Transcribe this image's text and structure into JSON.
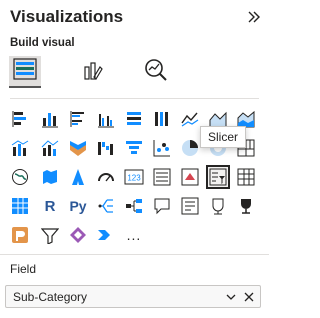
{
  "header": {
    "title": "Visualizations",
    "collapse_icon": "double-chevron-right-icon"
  },
  "build": {
    "title": "Build visual",
    "modes": [
      {
        "icon": "build-visual-icon",
        "active": true
      },
      {
        "icon": "format-visual-icon",
        "active": false
      },
      {
        "icon": "analytics-icon",
        "active": false
      }
    ]
  },
  "visuals": [
    "stacked-bar-icon",
    "stacked-column-icon",
    "clustered-bar-icon",
    "clustered-column-icon",
    "100-stacked-bar-icon",
    "100-stacked-column-icon",
    "line-chart-icon",
    "area-chart-icon",
    "stacked-area-icon",
    "line-clustered-column-icon",
    "line-stacked-column-icon",
    "ribbon-chart-icon",
    "waterfall-chart-icon",
    "funnel-chart-icon",
    "scatter-chart-icon",
    "pie-chart-icon",
    "donut-chart-icon",
    "treemap-icon",
    "map-icon",
    "filled-map-icon",
    "azure-map-icon",
    "gauge-icon",
    "card-icon",
    "multi-row-card-icon",
    "kpi-icon",
    "slicer-icon",
    "table-icon",
    "matrix-icon",
    "r-visual-icon",
    "python-visual-icon",
    "key-influencers-icon",
    "decomposition-tree-icon",
    "qa-icon",
    "narrative-icon",
    "paginated-report-icon",
    "metrics-icon",
    "power-apps-icon",
    "power-automate-icon",
    "diamond-visual-icon",
    "chevrons-visual-icon",
    "more-visuals-icon"
  ],
  "tooltip": {
    "text": "Slicer"
  },
  "field": {
    "label": "Field",
    "value": "Sub-Category",
    "icons": [
      "chevron-down-icon",
      "remove-icon"
    ]
  },
  "colors": {
    "accent": "#118dff",
    "border": "#c8c6c4",
    "selected": "#252423"
  },
  "more_glyph": "..."
}
